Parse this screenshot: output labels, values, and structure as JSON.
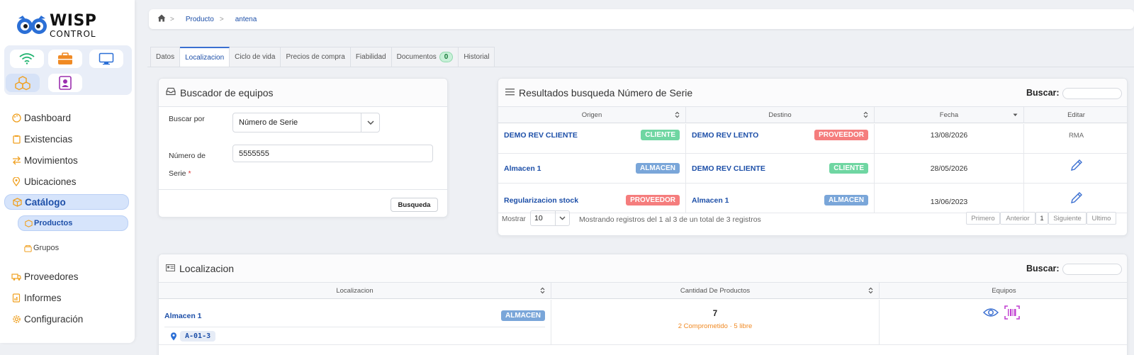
{
  "brand": {
    "line1": "WISP",
    "line2": "CONTROL"
  },
  "modules": [
    {
      "icon": "wifi-icon"
    },
    {
      "icon": "briefcase-icon"
    },
    {
      "icon": "monitor-icon"
    },
    {
      "icon": "boxes-icon"
    },
    {
      "icon": "contact-icon"
    }
  ],
  "nav": {
    "items": [
      {
        "label": "Dashboard",
        "icon": "palette-icon"
      },
      {
        "label": "Existencias",
        "icon": "clipboard-icon"
      },
      {
        "label": "Movimientos",
        "icon": "swap-icon"
      },
      {
        "label": "Ubicaciones",
        "icon": "location-icon"
      },
      {
        "label": "Catálogo",
        "icon": "box-icon"
      },
      {
        "label": "Proveedores",
        "icon": "truck-icon"
      },
      {
        "label": "Informes",
        "icon": "report-icon"
      },
      {
        "label": "Configuración",
        "icon": "gear-icon"
      }
    ],
    "sub": [
      {
        "label": "Productos"
      },
      {
        "label": "Grupos"
      }
    ]
  },
  "breadcrumb": {
    "sep": ">",
    "level1": "Producto",
    "level2": "antena"
  },
  "tabs": [
    {
      "label": "Datos"
    },
    {
      "label": "Localizacion"
    },
    {
      "label": "Ciclo de vida"
    },
    {
      "label": "Precios de compra"
    },
    {
      "label": "Fiabilidad"
    },
    {
      "label": "Documentos",
      "count": "0"
    },
    {
      "label": "Historial"
    }
  ],
  "buscador": {
    "title": "Buscador de equipos",
    "buscar_por_label": "Buscar por",
    "buscar_por_value": "Número de Serie",
    "serie_label_1": "Número de",
    "serie_label_2": "Serie",
    "required_mark": "*",
    "serie_value": "5555555",
    "button": "Busqueda"
  },
  "resultados": {
    "title": "Resultados busqueda Número de Serie",
    "search_label": "Buscar:",
    "columns": [
      "Origen",
      "Destino",
      "Fecha",
      "Editar"
    ],
    "rows": [
      {
        "origen": "DEMO REV CLIENTE",
        "origen_badge": "CLIENTE",
        "destino": "DEMO REV LENTO",
        "destino_badge": "PROVEEDOR",
        "fecha": "13/08/2026",
        "editar": "RMA"
      },
      {
        "origen": "Almacen 1",
        "origen_badge": "ALMACEN",
        "destino": "DEMO REV CLIENTE",
        "destino_badge": "CLIENTE",
        "fecha": "28/05/2026",
        "editar": ""
      },
      {
        "origen": "Regularizacion stock",
        "origen_badge": "PROVEEDOR",
        "destino": "Almacen 1",
        "destino_badge": "ALMACEN",
        "fecha": "13/06/2023",
        "editar": ""
      }
    ],
    "mostrar_label": "Mostrar",
    "page_size": "10",
    "info": "Mostrando registros del 1 al 3 de un total de 3 registros",
    "pager": {
      "first": "Primero",
      "prev": "Anterior",
      "page": "1",
      "next": "Siguiente",
      "last": "Ultimo"
    }
  },
  "localizacion": {
    "title": "Localizacion",
    "search_label": "Buscar:",
    "columns": [
      "Localizacion",
      "Cantidad De Productos",
      "Equipos"
    ],
    "row": {
      "name": "Almacen 1",
      "badge": "ALMACEN",
      "code": "A-01-3",
      "cantidad": "7",
      "detalle": "2 Comprometido · 5 libre"
    }
  },
  "colors": {
    "accent": "#1d4fa8",
    "cliente": "#6fd6a2",
    "proveedor": "#f57d7d",
    "almacen": "#7aa6d9"
  }
}
